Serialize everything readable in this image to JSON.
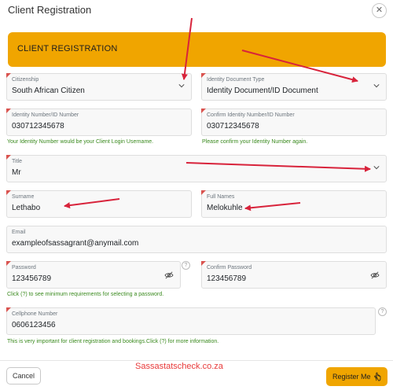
{
  "header": {
    "title": "Client Registration",
    "close_icon": "close-icon"
  },
  "banner": {
    "title": "CLIENT REGISTRATION",
    "color": "#f0a500"
  },
  "form": {
    "citizenship": {
      "label": "Citizenship",
      "value": "South African Citizen"
    },
    "id_doc_type": {
      "label": "Identity Document Type",
      "value": "Identity Document/ID Document"
    },
    "id_number": {
      "label": "Identity Number/ID Number",
      "value": "030712345678",
      "hint": "Your Identity Number would be your Client Login Username."
    },
    "confirm_id": {
      "label": "Confirm Identity Number/ID Number",
      "value": "030712345678",
      "hint": "Please confirm your Identity Number again."
    },
    "title": {
      "label": "Title",
      "value": "Mr"
    },
    "surname": {
      "label": "Surname",
      "value": "Lethabo"
    },
    "full_names": {
      "label": "Full Names",
      "value": "Melokuhle"
    },
    "email": {
      "label": "Email",
      "value": "exampleofsassagrant@anymail.com"
    },
    "password": {
      "label": "Password",
      "value": "123456789",
      "help": "?",
      "hint": "Click (?) to see minimum requirements for selecting a password."
    },
    "confirm_password": {
      "label": "Confirm Password",
      "value": "123456789"
    },
    "cellphone": {
      "label": "Cellphone Number",
      "value": "0606123456",
      "help": "?",
      "hint": "This is very important for client registration and bookings.Click (?) for more information."
    }
  },
  "footer": {
    "cancel_label": "Cancel",
    "watermark": "Sassastatscheck.co.za",
    "register_label": "Register Me",
    "register_icon": "hand-pointer-icon"
  },
  "colors": {
    "accent": "#f0a500",
    "annotation": "#d8233b",
    "hint": "#3a8a1e",
    "required_marker": "#d9534f"
  }
}
